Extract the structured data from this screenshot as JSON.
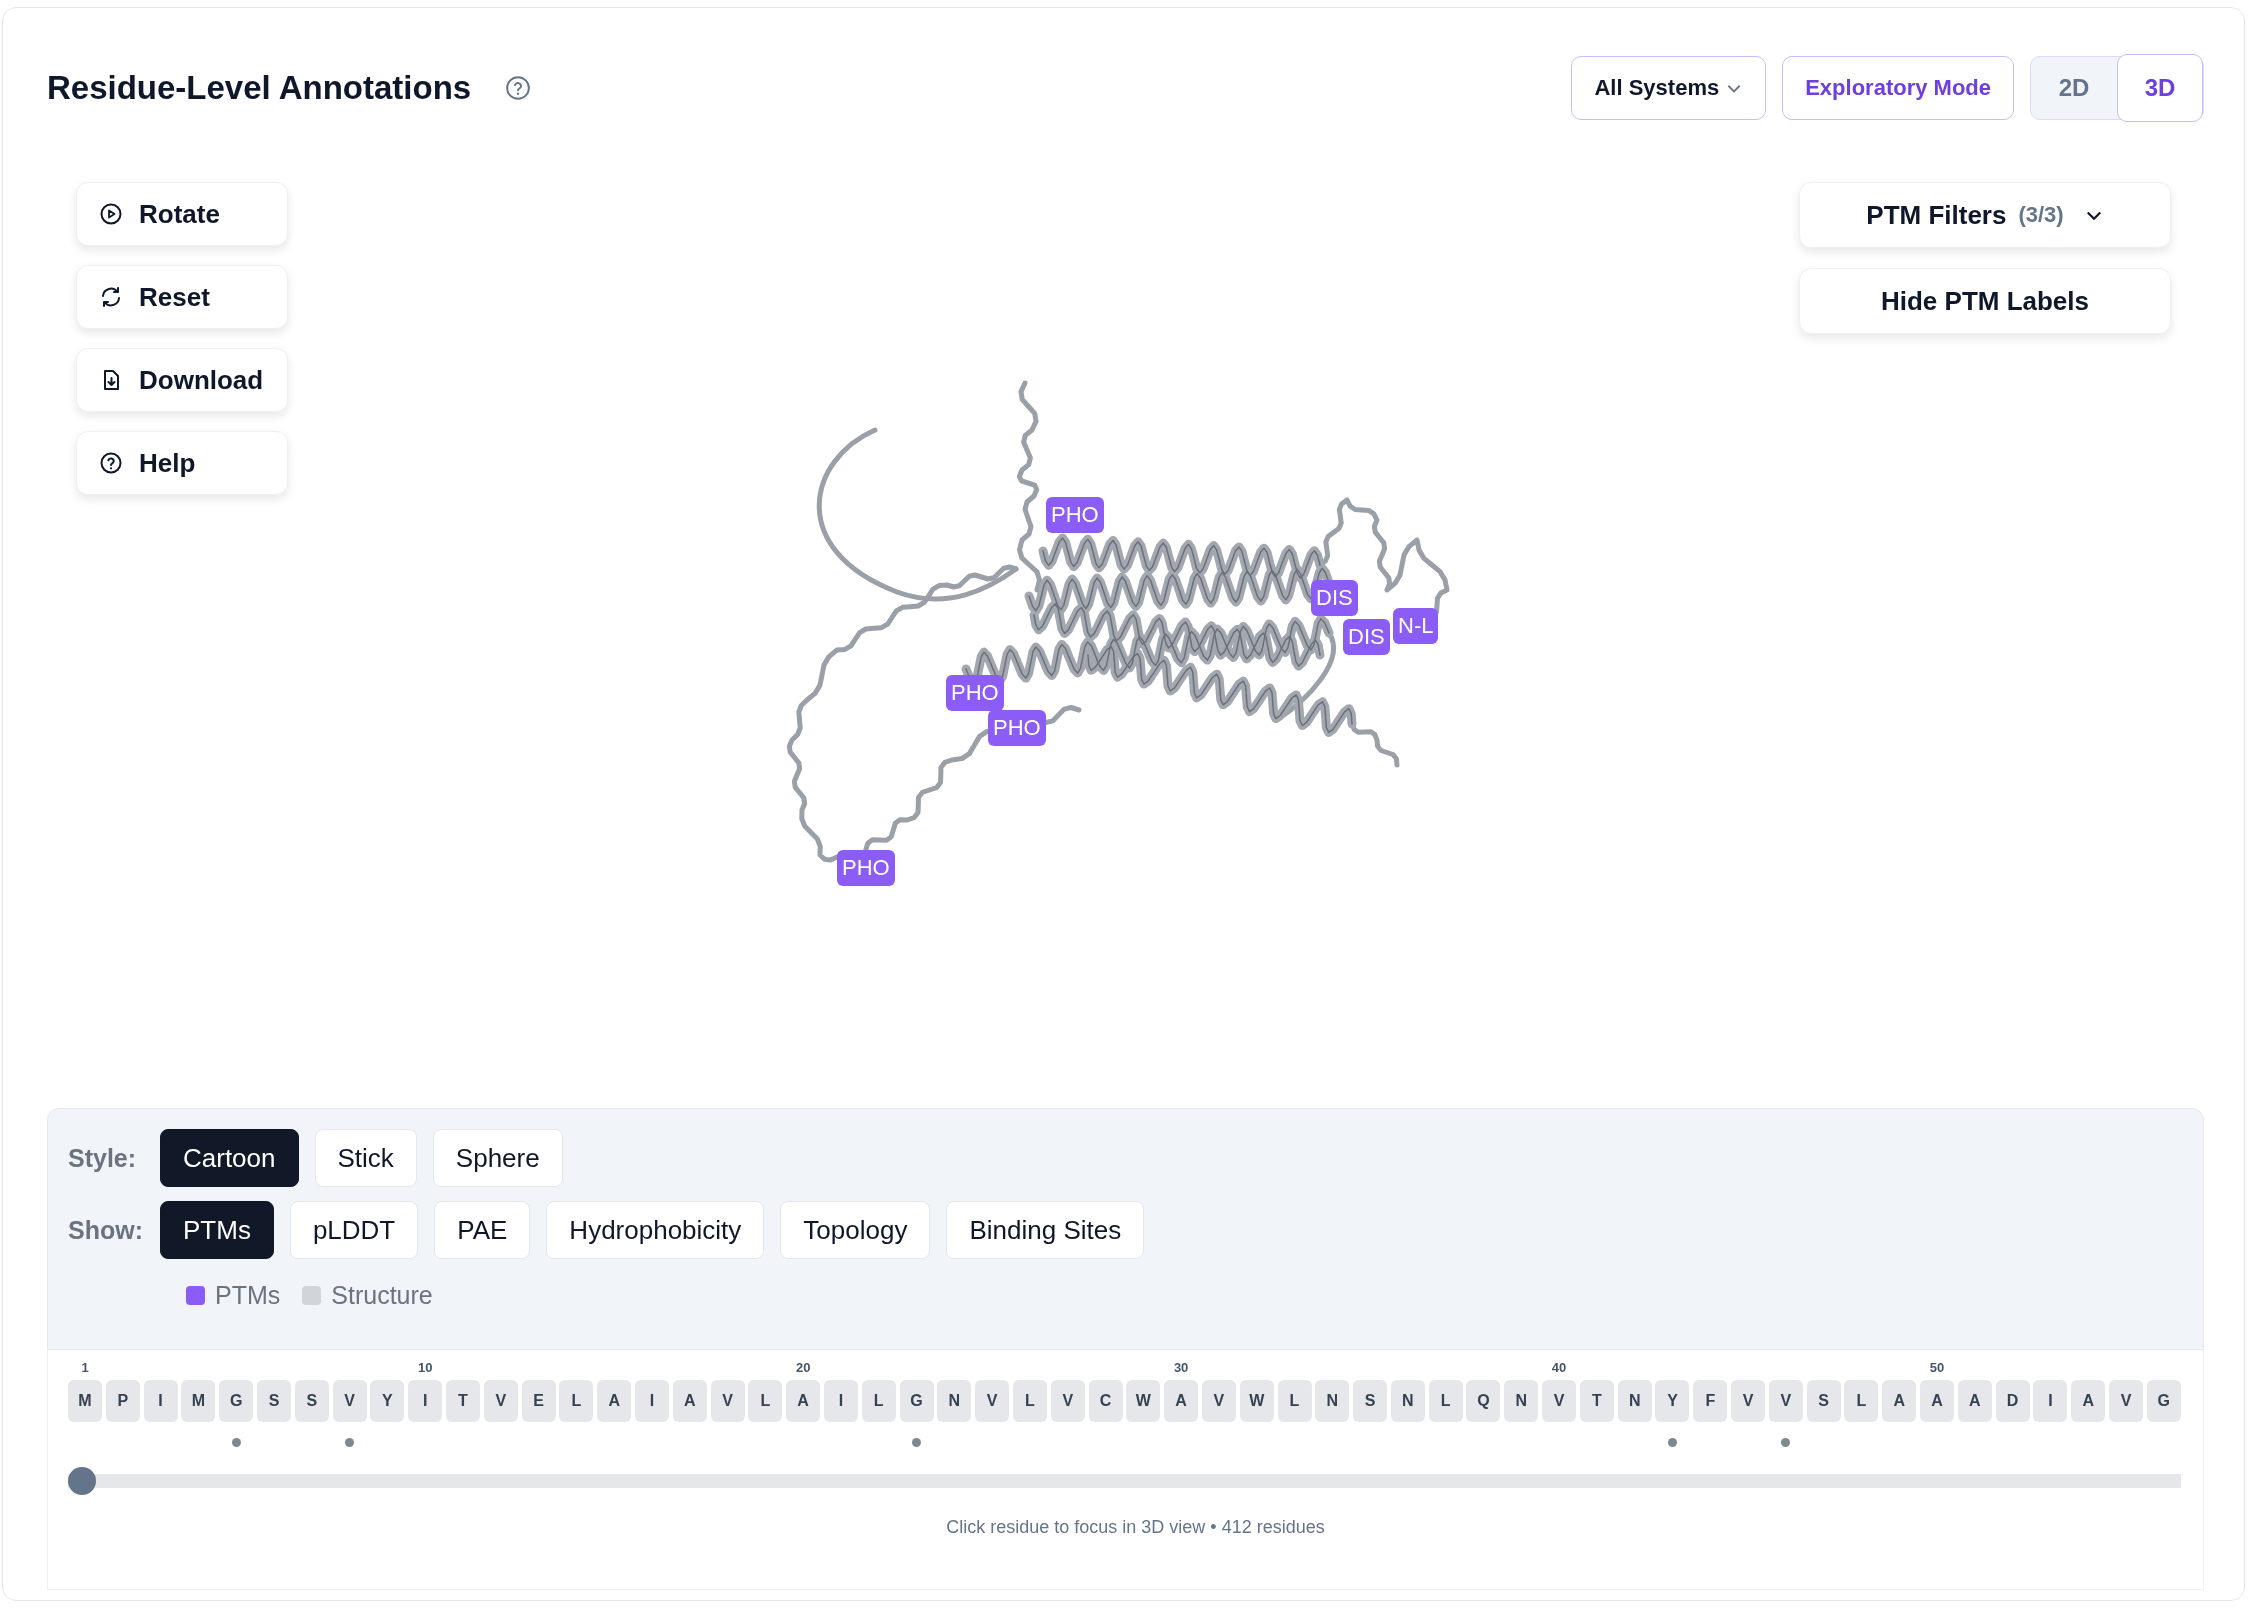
{
  "header": {
    "title": "Residue-Level Annotations",
    "system_dropdown": "All Systems",
    "mode_button": "Exploratory Mode",
    "view_toggle": [
      {
        "label": "2D",
        "selected": false
      },
      {
        "label": "3D",
        "selected": true
      }
    ]
  },
  "viewer": {
    "tools": [
      {
        "label": "Rotate",
        "kind": "rotate"
      },
      {
        "label": "Reset",
        "kind": "reset"
      },
      {
        "label": "Download",
        "kind": "download"
      },
      {
        "label": "Help",
        "kind": "help"
      }
    ],
    "ptm_filters": {
      "label": "PTM Filters",
      "count": "(3/3)"
    },
    "labels_button": "Hide PTM Labels",
    "ptm_labels": [
      "PHO",
      "DIS",
      "DIS",
      "N-L",
      "PHO",
      "PHO",
      "PHO"
    ]
  },
  "controls": {
    "style_label": "Style:",
    "styles": [
      {
        "label": "Cartoon",
        "selected": true
      },
      {
        "label": "Stick",
        "selected": false
      },
      {
        "label": "Sphere",
        "selected": false
      }
    ],
    "show_label": "Show:",
    "layers": [
      {
        "label": "PTMs",
        "selected": true
      },
      {
        "label": "pLDDT",
        "selected": false
      },
      {
        "label": "PAE",
        "selected": false
      },
      {
        "label": "Hydrophobicity",
        "selected": false
      },
      {
        "label": "Topology",
        "selected": false
      },
      {
        "label": "Binding Sites",
        "selected": false
      }
    ],
    "legend": [
      {
        "label": "PTMs",
        "color": "#8b5cf6"
      },
      {
        "label": "Structure",
        "color": "#d1d5db"
      }
    ]
  },
  "sequence": {
    "residues": [
      {
        "letter": "M",
        "tick": "1",
        "ptm": false
      },
      {
        "letter": "P",
        "ptm": false
      },
      {
        "letter": "I",
        "ptm": false
      },
      {
        "letter": "M",
        "ptm": false
      },
      {
        "letter": "G",
        "ptm": true
      },
      {
        "letter": "S",
        "ptm": false
      },
      {
        "letter": "S",
        "ptm": false
      },
      {
        "letter": "V",
        "ptm": true
      },
      {
        "letter": "Y",
        "ptm": false
      },
      {
        "letter": "I",
        "tick": "10",
        "ptm": false
      },
      {
        "letter": "T",
        "ptm": false
      },
      {
        "letter": "V",
        "ptm": false
      },
      {
        "letter": "E",
        "ptm": false
      },
      {
        "letter": "L",
        "ptm": false
      },
      {
        "letter": "A",
        "ptm": false
      },
      {
        "letter": "I",
        "ptm": false
      },
      {
        "letter": "A",
        "ptm": false
      },
      {
        "letter": "V",
        "ptm": false
      },
      {
        "letter": "L",
        "ptm": false
      },
      {
        "letter": "A",
        "tick": "20",
        "ptm": false
      },
      {
        "letter": "I",
        "ptm": false
      },
      {
        "letter": "L",
        "ptm": false
      },
      {
        "letter": "G",
        "ptm": true
      },
      {
        "letter": "N",
        "ptm": false
      },
      {
        "letter": "V",
        "ptm": false
      },
      {
        "letter": "L",
        "ptm": false
      },
      {
        "letter": "V",
        "ptm": false
      },
      {
        "letter": "C",
        "ptm": false
      },
      {
        "letter": "W",
        "ptm": false
      },
      {
        "letter": "A",
        "tick": "30",
        "ptm": false
      },
      {
        "letter": "V",
        "ptm": false
      },
      {
        "letter": "W",
        "ptm": false
      },
      {
        "letter": "L",
        "ptm": false
      },
      {
        "letter": "N",
        "ptm": false
      },
      {
        "letter": "S",
        "ptm": false
      },
      {
        "letter": "N",
        "ptm": false
      },
      {
        "letter": "L",
        "ptm": false
      },
      {
        "letter": "Q",
        "ptm": false
      },
      {
        "letter": "N",
        "ptm": false
      },
      {
        "letter": "V",
        "tick": "40",
        "ptm": false
      },
      {
        "letter": "T",
        "ptm": false
      },
      {
        "letter": "N",
        "ptm": false
      },
      {
        "letter": "Y",
        "ptm": true
      },
      {
        "letter": "F",
        "ptm": false
      },
      {
        "letter": "V",
        "ptm": false
      },
      {
        "letter": "V",
        "ptm": true
      },
      {
        "letter": "S",
        "ptm": false
      },
      {
        "letter": "L",
        "ptm": false
      },
      {
        "letter": "A",
        "ptm": false
      },
      {
        "letter": "A",
        "tick": "50",
        "ptm": false
      },
      {
        "letter": "A",
        "ptm": false
      },
      {
        "letter": "D",
        "ptm": false
      },
      {
        "letter": "I",
        "ptm": false
      },
      {
        "letter": "A",
        "ptm": false
      },
      {
        "letter": "V",
        "ptm": false
      },
      {
        "letter": "G",
        "ptm": false
      }
    ],
    "slider": {
      "level": 0
    },
    "hint": "Click residue to focus in 3D view • 412 residues"
  }
}
